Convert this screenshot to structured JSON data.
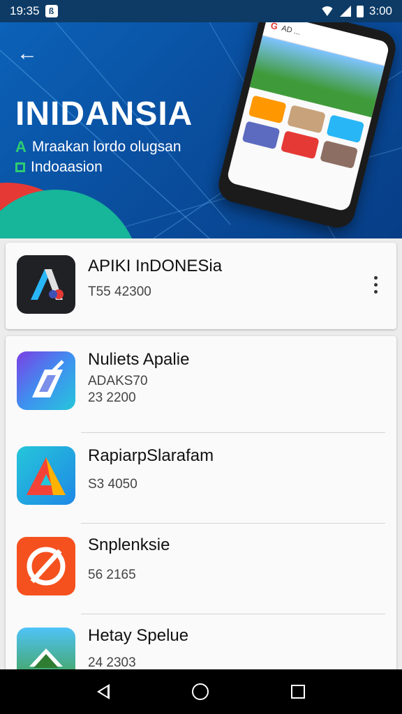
{
  "status_bar": {
    "time": "19:35",
    "notification_glyph": "ß",
    "battery_text": "3:00"
  },
  "hero": {
    "title": "INIDANSIA",
    "line1_bullet": "A",
    "line1_text": "Mraakan lordo olugsan",
    "line2_text": "Indoaasion",
    "phone_search_text": "AD ...",
    "phone_logo": "G"
  },
  "featured_app": {
    "name": "APIKI InDONESia",
    "subtitle": "T55 42300"
  },
  "apps": [
    {
      "name": "Nuliets Apalie",
      "line1": "ADAKS70",
      "line2": "23 2200"
    },
    {
      "name": "RapiarpSlarafam",
      "line1": "S3 4050",
      "line2": ""
    },
    {
      "name": "Snplenksie",
      "line1": "56 2165",
      "line2": ""
    },
    {
      "name": "Hetay Spelue",
      "line1": "24 2303",
      "line2": ""
    }
  ],
  "colors": {
    "hero_blue": "#0a4fa0",
    "accent_green": "#2ecc71",
    "status_bar": "#0d3b66"
  }
}
